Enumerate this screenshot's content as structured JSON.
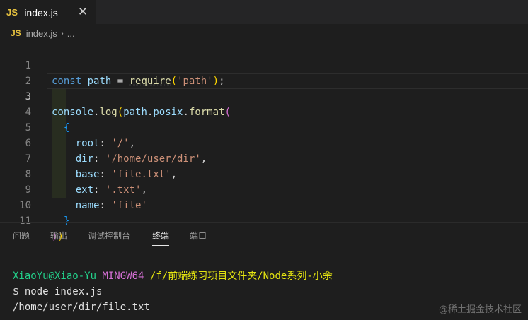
{
  "tab": {
    "icon": "JS",
    "label": "index.js",
    "close_glyph": "✕"
  },
  "breadcrumb": {
    "icon": "JS",
    "file": "index.js",
    "sep": "›",
    "more": "..."
  },
  "editor": {
    "line_numbers": [
      "1",
      "2",
      "3",
      "4",
      "5",
      "6",
      "7",
      "8",
      "9",
      "10",
      "11"
    ],
    "line1": {
      "kw": "const",
      "var": "path",
      "op": "=",
      "fn": "require",
      "p1": "(",
      "str": "'path'",
      "p2": ")",
      "end": ";"
    },
    "line3": {
      "obj": "console",
      "dot1": ".",
      "m1": "log",
      "p1": "(",
      "obj2": "path",
      "dot2": ".",
      "obj3": "posix",
      "dot3": ".",
      "m2": "format",
      "p2": "("
    },
    "line4": {
      "brace": "{"
    },
    "line5": {
      "key": "root",
      "colon": ":",
      "val": "'/'",
      "comma": ","
    },
    "line6": {
      "key": "dir",
      "colon": ":",
      "val": "'/home/user/dir'",
      "comma": ","
    },
    "line7": {
      "key": "base",
      "colon": ":",
      "val": "'file.txt'",
      "comma": ","
    },
    "line8": {
      "key": "ext",
      "colon": ":",
      "val": "'.txt'",
      "comma": ","
    },
    "line9": {
      "key": "name",
      "colon": ":",
      "val": "'file'"
    },
    "line10": {
      "brace": "}"
    },
    "line11": {
      "p1": ")",
      "p2": ")"
    }
  },
  "panel": {
    "tabs": [
      "问题",
      "输出",
      "调试控制台",
      "终端",
      "端口"
    ],
    "active_tab": "终端"
  },
  "terminal": {
    "user": "XiaoYu@Xiao-Yu",
    "env": "MINGW64",
    "path": "/f/前端练习项目文件夹/Node系列-小余",
    "command": "$ node index.js",
    "output": "/home/user/dir/file.txt"
  },
  "watermark": "@稀土掘金技术社区",
  "colors": {
    "background": "#1e1e1e",
    "keyword": "#569cd6",
    "variable": "#9cdcfe",
    "function": "#dcdcaa",
    "string": "#ce9178",
    "js_icon": "#e8c33f"
  }
}
